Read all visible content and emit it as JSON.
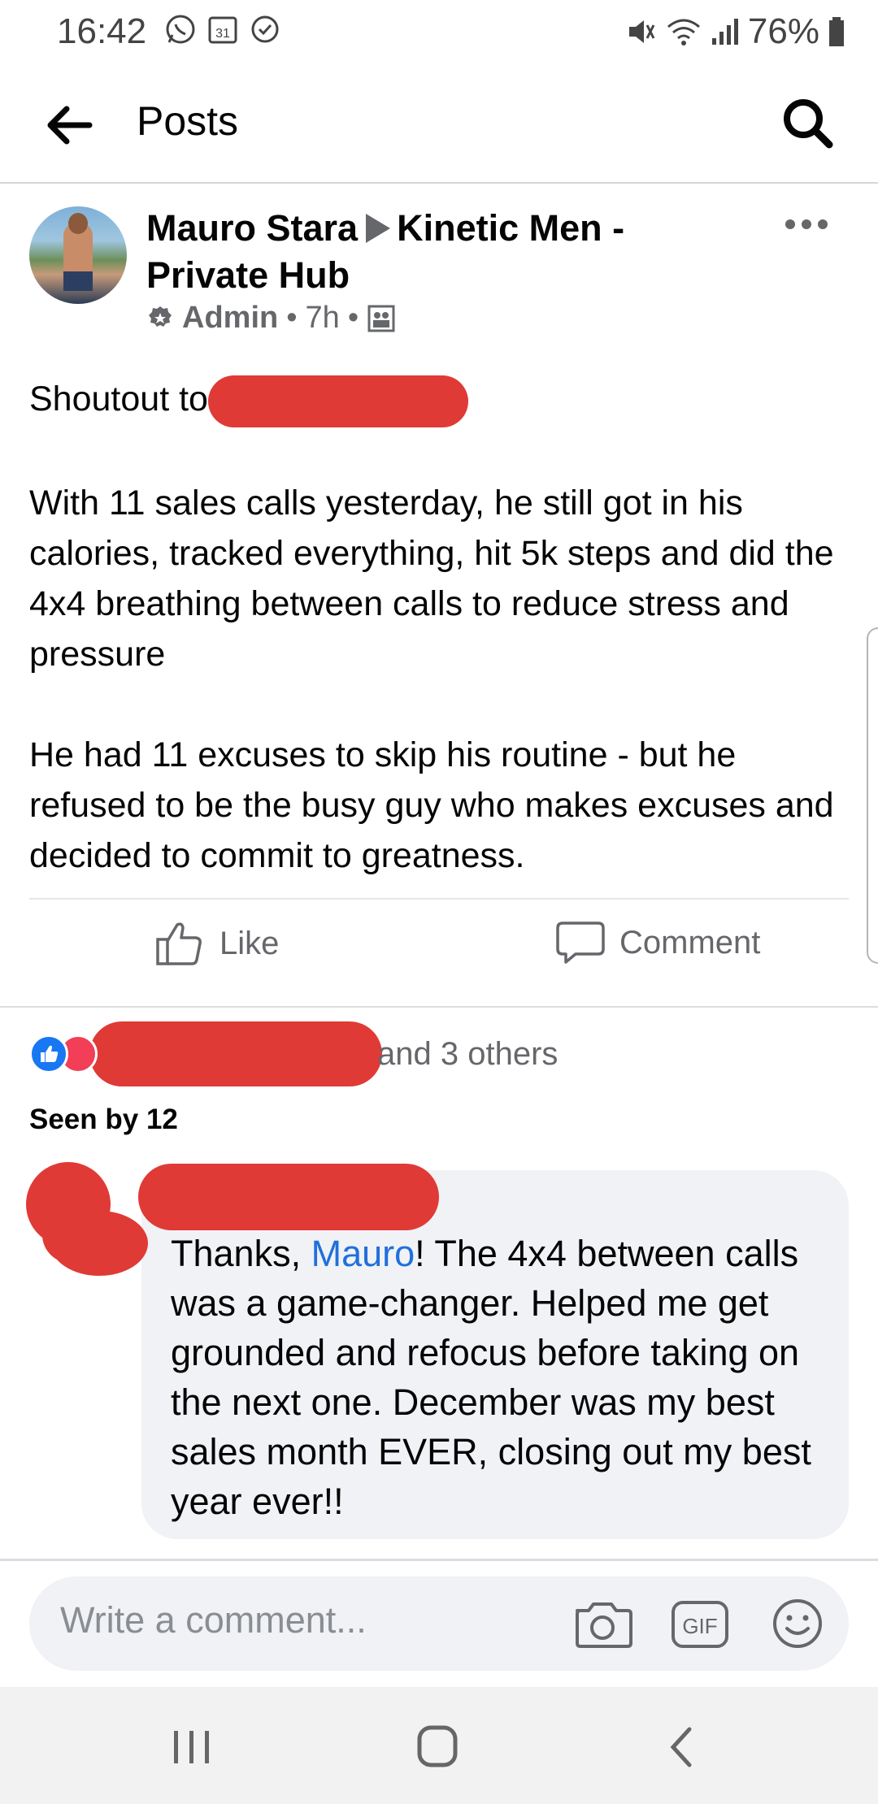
{
  "status_bar": {
    "time": "16:42",
    "battery_pct": "76%",
    "left_icons": [
      "whatsapp-icon",
      "calendar-31-icon",
      "check-icon"
    ],
    "right_icons": [
      "mute-icon",
      "wifi-icon",
      "signal-icon",
      "battery-icon"
    ]
  },
  "header": {
    "title": "Posts"
  },
  "post": {
    "author": "Mauro Stara",
    "group": "Kinetic Men - Private Hub",
    "role": "Admin",
    "time": "7h",
    "shoutout_prefix": "Shoutout to",
    "paragraph_1": "With 11 sales calls yesterday, he still got in his calories, tracked everything, hit 5k steps and did the 4x4 breathing between calls to reduce stress and pressure",
    "paragraph_2": "He had 11 excuses to skip his routine - but he refused to be the busy guy who makes excuses and decided to commit to greatness.",
    "like_label": "Like",
    "comment_label": "Comment"
  },
  "reactions": {
    "others_text": "and 3 others"
  },
  "seen_by": "Seen by 12",
  "comment": {
    "text_prefix": "Thanks, ",
    "mention": "Mauro",
    "text_suffix": "! The 4x4 between calls was a game-changer. Helped me get grounded and refocus before taking on the next one. December was my best sales month EVER, closing out my best year ever!!"
  },
  "composer": {
    "placeholder": "Write a comment..."
  },
  "colors": {
    "accent": "#1877f2",
    "mention": "#216fdb",
    "redaction": "#e03a36",
    "muted": "#65676b"
  }
}
